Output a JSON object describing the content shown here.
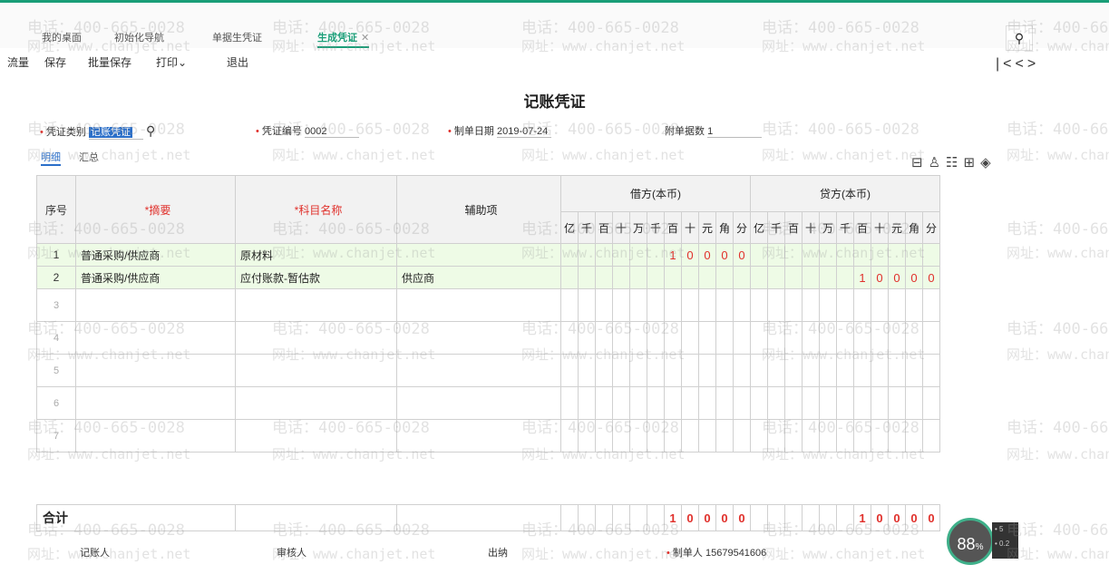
{
  "tabs": [
    "我的桌面",
    "初始化导航",
    "单据生凭证",
    "生成凭证"
  ],
  "toolbar": [
    "流量",
    "保存",
    "批量保存",
    "打印",
    "退出"
  ],
  "title": "记账凭证",
  "form": {
    "type_label": "凭证类别",
    "type_value": "记账凭证",
    "num_label": "凭证编号",
    "num_value": "0002",
    "date_label": "制单日期",
    "date_value": "2019-07-24",
    "attach_label": "附单据数",
    "attach_value": "1"
  },
  "subtabs": [
    "明细",
    "汇总"
  ],
  "table": {
    "h_seq": "序号",
    "h_summary": "*摘要",
    "h_account": "*科目名称",
    "h_aux": "辅助项",
    "h_debit": "借方(本币)",
    "h_credit": "贷方(本币)",
    "digits": [
      "亿",
      "千",
      "百",
      "十",
      "万",
      "千",
      "百",
      "十",
      "元",
      "角",
      "分"
    ],
    "rows": [
      {
        "seq": "1",
        "summary": "普通采购/供应商",
        "account": "原材料",
        "aux": "",
        "debit": "10000",
        "credit": ""
      },
      {
        "seq": "2",
        "summary": "普通采购/供应商",
        "account": "应付账款-暂估款",
        "aux": "供应商",
        "debit": "",
        "credit": "10000"
      },
      {
        "seq": "3"
      },
      {
        "seq": "4"
      },
      {
        "seq": "5"
      },
      {
        "seq": "6"
      },
      {
        "seq": "7"
      }
    ]
  },
  "total": {
    "label": "合计",
    "debit": "10000",
    "credit": "10000"
  },
  "footer": {
    "bookkeeper": "记账人",
    "auditor": "审核人",
    "cashier": "出纳",
    "maker_label": "制单人",
    "maker": "15679541606"
  },
  "badge": {
    "value": "88",
    "unit": "%",
    "a": "5",
    "b": "0.2"
  },
  "watermark": {
    "phone": "电话：400-665-0028",
    "site": "网址：www.chanjet.net"
  }
}
